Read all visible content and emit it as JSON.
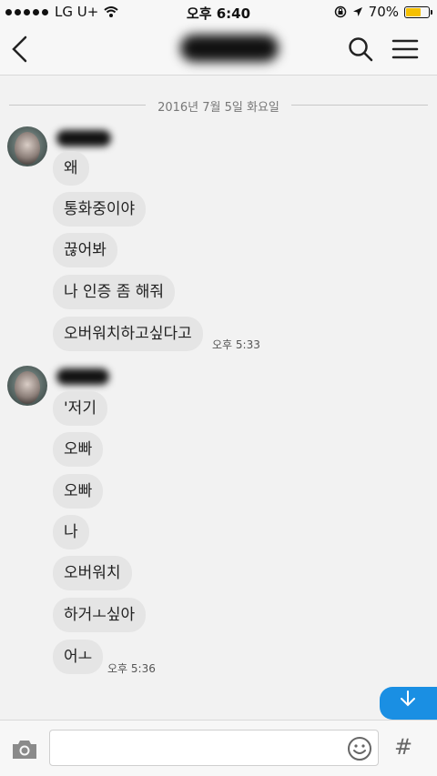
{
  "status_bar": {
    "carrier": "LG U+",
    "time": "오후 6:40",
    "battery_percent": "70%",
    "battery_level": 0.7
  },
  "header": {
    "back_icon": "chevron-left-icon",
    "search_icon": "search-icon",
    "menu_icon": "menu-icon"
  },
  "chat": {
    "date_divider": "2016년 7월 5일 화요일",
    "groups": [
      {
        "messages": [
          "왜",
          "통화중이야",
          "끊어봐",
          "나 인증 좀 해줘",
          "오버워치하고싶다고"
        ],
        "timestamp": "오후 5:33"
      },
      {
        "messages": [
          "'저기",
          "오빠",
          "오빠",
          "나",
          "오버워치",
          "하거ㅗ싶아",
          "어ㅗ"
        ],
        "timestamp": "오후 5:36"
      }
    ]
  },
  "input_bar": {
    "camera_icon": "camera-icon",
    "message_value": "",
    "emoji_icon": "emoji-icon",
    "hash_label": "#"
  },
  "colors": {
    "accent": "#1a8fe3",
    "bubble": "#e5e5e5",
    "background": "#f2f2f2"
  }
}
